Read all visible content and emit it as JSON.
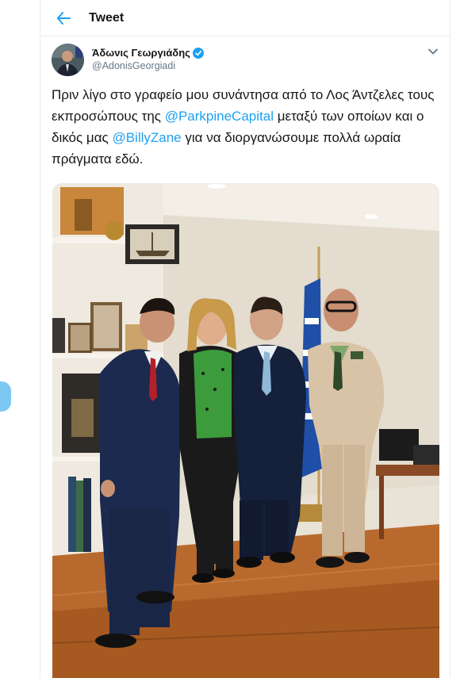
{
  "header": {
    "back_icon": "arrow-left-icon",
    "title": "Tweet"
  },
  "tweet": {
    "author": {
      "display_name": "Άδωνις Γεωργιάδης",
      "handle": "@AdonisGeorgiadi",
      "verified": true
    },
    "text_1": "Πριν λίγο στο γραφείο μου συνάντησα από το Λος Άντζελες τους εκπροσώπους της ",
    "mention_1": "@ParkpineCapital",
    "text_2": " μεταξύ των οποίων και ο δικός μας ",
    "mention_2": "@BillyZane",
    "text_3": " για να διοργανώσουμε πολλά ωραία πράγματα εδώ."
  },
  "colors": {
    "accent": "#1da1f2",
    "secondary_text": "#657786",
    "border": "#e6ecf0"
  }
}
